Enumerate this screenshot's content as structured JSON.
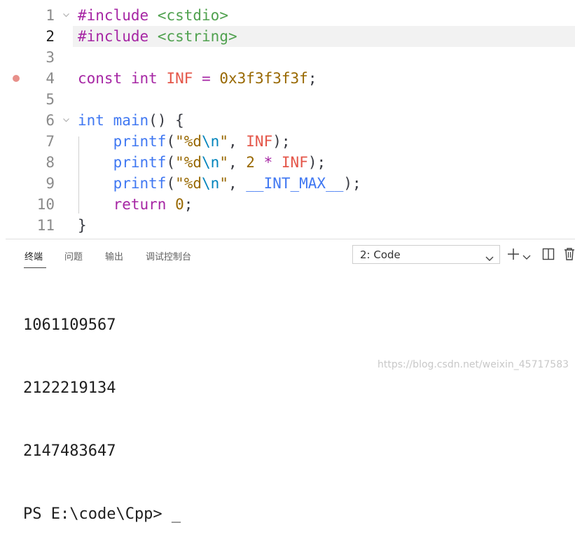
{
  "editor": {
    "lines": [
      {
        "n": "1",
        "code": [
          [
            "#include",
            "c-kw"
          ],
          [
            " ",
            ""
          ],
          [
            "<cstdio>",
            "c-inc"
          ]
        ]
      },
      {
        "n": "2",
        "code": [
          [
            "#include",
            "c-kw"
          ],
          [
            " ",
            ""
          ],
          [
            "<cstring>",
            "c-inc"
          ]
        ]
      },
      {
        "n": "3",
        "code": []
      },
      {
        "n": "4",
        "code": [
          [
            "const",
            "c-kw"
          ],
          [
            " ",
            ""
          ],
          [
            "int",
            "c-kw"
          ],
          [
            " ",
            ""
          ],
          [
            "INF",
            "c-const"
          ],
          [
            " ",
            ""
          ],
          [
            "=",
            "c-op"
          ],
          [
            " ",
            ""
          ],
          [
            "0x3f3f3f3f",
            "c-num"
          ],
          [
            ";",
            "c-pn"
          ]
        ]
      },
      {
        "n": "5",
        "code": []
      },
      {
        "n": "6",
        "code": [
          [
            "int",
            "c-ty"
          ],
          [
            " ",
            ""
          ],
          [
            "main",
            "c-fn"
          ],
          [
            "() {",
            "c-pn"
          ]
        ]
      },
      {
        "n": "7",
        "code": [
          [
            "    ",
            ""
          ],
          [
            "printf",
            "c-fn"
          ],
          [
            "(",
            "c-pn"
          ],
          [
            "\"%d",
            "c-num"
          ],
          [
            "\\n",
            "c-esc"
          ],
          [
            "\"",
            "c-num"
          ],
          [
            ", ",
            "c-pn"
          ],
          [
            "INF",
            "c-const"
          ],
          [
            ");",
            "c-pn"
          ]
        ]
      },
      {
        "n": "8",
        "code": [
          [
            "    ",
            ""
          ],
          [
            "printf",
            "c-fn"
          ],
          [
            "(",
            "c-pn"
          ],
          [
            "\"%d",
            "c-num"
          ],
          [
            "\\n",
            "c-esc"
          ],
          [
            "\"",
            "c-num"
          ],
          [
            ", ",
            "c-pn"
          ],
          [
            "2",
            "c-num"
          ],
          [
            " ",
            ""
          ],
          [
            "*",
            "c-op"
          ],
          [
            " ",
            ""
          ],
          [
            "INF",
            "c-const"
          ],
          [
            ");",
            "c-pn"
          ]
        ]
      },
      {
        "n": "9",
        "code": [
          [
            "    ",
            ""
          ],
          [
            "printf",
            "c-fn"
          ],
          [
            "(",
            "c-pn"
          ],
          [
            "\"%d",
            "c-num"
          ],
          [
            "\\n",
            "c-esc"
          ],
          [
            "\"",
            "c-num"
          ],
          [
            ", ",
            "c-pn"
          ],
          [
            "__INT_MAX__",
            "c-ty"
          ],
          [
            ");",
            "c-pn"
          ]
        ]
      },
      {
        "n": "10",
        "code": [
          [
            "    ",
            ""
          ],
          [
            "return",
            "c-kw"
          ],
          [
            " ",
            ""
          ],
          [
            "0",
            "c-num"
          ],
          [
            ";",
            "c-pn"
          ]
        ]
      },
      {
        "n": "11",
        "code": [
          [
            "}",
            "c-pn"
          ]
        ]
      }
    ]
  },
  "panel": {
    "tabs": [
      "终端",
      "问题",
      "输出",
      "调试控制台"
    ],
    "terminal_select": "2: Code"
  },
  "terminal": {
    "output": [
      "1061109567",
      "2122219134",
      "2147483647",
      "PS E:\\code\\Cpp> _"
    ]
  },
  "watermark": "https://blog.csdn.net/weixin_45717583",
  "colors": {
    "keyword": "#a626a4",
    "type": "#4078f2",
    "constant": "#e45649",
    "number": "#986801",
    "include": "#50a14f",
    "breakpoint": "#e8908a"
  },
  "icons": {
    "fold": "chevron-down-icon",
    "add": "plus-icon",
    "split": "split-icon",
    "trash": "trash-icon"
  }
}
